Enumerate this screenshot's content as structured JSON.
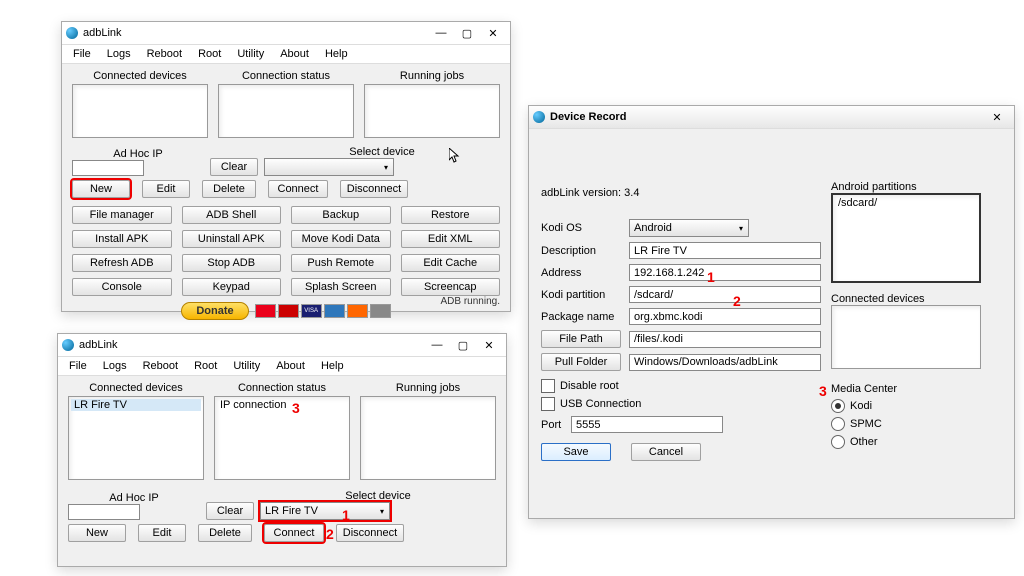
{
  "app_title": "adbLink",
  "menus": [
    "File",
    "Logs",
    "Reboot",
    "Root",
    "Utility",
    "About",
    "Help"
  ],
  "labels": {
    "connected_devices": "Connected devices",
    "connection_status": "Connection status",
    "running_jobs": "Running jobs",
    "adhoc_ip": "Ad Hoc IP",
    "select_device": "Select device",
    "clear": "Clear",
    "new": "New",
    "edit": "Edit",
    "delete": "Delete",
    "connect": "Connect",
    "disconnect": "Disconnect"
  },
  "grid_buttons_top": [
    "File manager",
    "ADB Shell",
    "Backup",
    "Restore",
    "Install APK",
    "Uninstall APK",
    "Move Kodi Data",
    "Edit XML",
    "Refresh ADB",
    "Stop ADB",
    "Push Remote",
    "Edit Cache",
    "Console",
    "Keypad",
    "Splash Screen",
    "Screencap"
  ],
  "donate": "Donate",
  "status_running": "ADB running.",
  "bottom": {
    "device_item": "LR Fire TV",
    "conn_item": "IP connection",
    "select_value": "LR Fire TV"
  },
  "device_record": {
    "title": "Device Record",
    "version_label": "adbLink version: 3.4",
    "kodi_os_label": "Kodi OS",
    "kodi_os_value": "Android",
    "description_label": "Description",
    "description_value": "LR Fire TV",
    "address_label": "Address",
    "address_value": "192.168.1.242",
    "kodi_partition_label": "Kodi partition",
    "kodi_partition_value": "/sdcard/",
    "package_label": "Package name",
    "package_value": "org.xbmc.kodi",
    "file_path_btn": "File Path",
    "file_path_value": "/files/.kodi",
    "pull_folder_btn": "Pull Folder",
    "pull_folder_value": "Windows/Downloads/adbLink",
    "disable_root": "Disable root",
    "usb_conn": "USB Connection",
    "port_label": "Port",
    "port_value": "5555",
    "save": "Save",
    "cancel": "Cancel",
    "android_partitions": "Android partitions",
    "partition_item": "/sdcard/",
    "connected_devices": "Connected devices",
    "media_center": "Media Center",
    "mc_options": [
      "Kodi",
      "SPMC",
      "Other"
    ]
  },
  "annotations": {
    "n1": "1",
    "n2": "2",
    "n3": "3"
  }
}
